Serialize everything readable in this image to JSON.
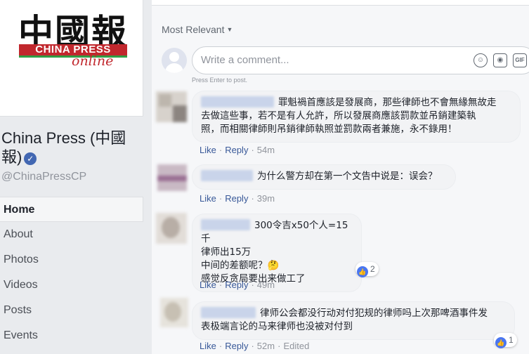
{
  "sidebar": {
    "logo": {
      "chars": "中國報",
      "bar_text": "CHINA PRESS",
      "script": "online"
    },
    "page_name": "China Press (中國報)",
    "handle": "@ChinaPressCP",
    "nav": [
      "Home",
      "About",
      "Photos",
      "Videos",
      "Posts",
      "Events"
    ]
  },
  "comments_panel": {
    "sort_label": "Most Relevant",
    "input_placeholder": "Write a comment...",
    "input_hint": "Press Enter to post.",
    "gif_label": "GIF",
    "actions": {
      "like": "Like",
      "reply": "Reply",
      "edited": "Edited"
    },
    "comments": [
      {
        "lines": [
          "罪魁禍首應該是發展商，那些律師也不會無緣無故走",
          "去做這些事，若不是有人允許，所以發展商應該罰款並吊銷建築執",
          "照，而相關律師則吊銷律師執照並罰款兩者兼施，永不錄用！"
        ],
        "time": "54m"
      },
      {
        "lines": [
          "为什么警方却在第一个文告中说是：误会？"
        ],
        "time": "39m"
      },
      {
        "lines": [
          "300令吉x50个人=15千",
          "律师出15万",
          "中间的差额呢？🤔",
          "感觉反贪局要出来做工了"
        ],
        "time": "49m",
        "reactions": "2"
      },
      {
        "lines": [
          "律师公会都没行动对付犯规的律师吗上次那啤酒事件发",
          "表极端言论的马来律师也没被对付到"
        ],
        "time": "52m",
        "edited": true,
        "reactions": "1"
      }
    ]
  },
  "colors": {
    "brand_blue": "#4267b2",
    "link": "#385898",
    "muted": "#90949c",
    "logo_red": "#c1272d"
  }
}
